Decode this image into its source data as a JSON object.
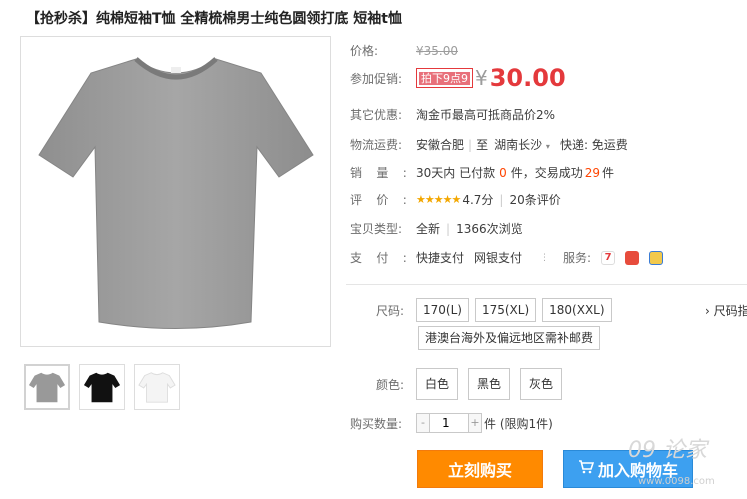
{
  "title": "【抢秒杀】纯棉短袖T恤 全精梳棉男士纯色圆领打底 短袖t恤",
  "price": {
    "label": "价格:",
    "original": "¥35.00"
  },
  "promo": {
    "label": "参加促销:",
    "tag": "拍下9点9",
    "yen": "¥",
    "price": "30.00"
  },
  "other": {
    "label": "其它优惠:",
    "text": "淘金币最高可抵商品价2%"
  },
  "shipping": {
    "label": "物流运费:",
    "from": "安徽合肥",
    "to_prefix": "至",
    "to": "湖南长沙",
    "express": "快递: 免运费"
  },
  "sales": {
    "label": "销量:",
    "prefix": "30天内 已付款",
    "paid": "0",
    "mid": "件，交易成功",
    "success": "29",
    "suffix": "件"
  },
  "rating": {
    "label": "评价:",
    "stars": "★★★★★",
    "score": "4.7分",
    "reviews": "20条评价"
  },
  "type": {
    "label": "宝贝类型:",
    "condition": "全新",
    "views": "1366次浏览"
  },
  "payment": {
    "label": "支付:",
    "methods": [
      "快捷支付",
      "网银支付"
    ],
    "service_label": "服务:"
  },
  "size": {
    "label": "尺码:",
    "options": [
      "170(L)",
      "175(XL)",
      "180(XXL)"
    ],
    "note": "港澳台海外及偏远地区需补邮费",
    "guide": "› 尺码指"
  },
  "color": {
    "label": "颜色:",
    "options": [
      "白色",
      "黑色",
      "灰色"
    ]
  },
  "quantity": {
    "label": "购买数量:",
    "value": "1",
    "minus": "-",
    "plus": "+",
    "unit": "件 (限购1件)"
  },
  "buttons": {
    "buy": "立刻购买",
    "cart": "加入购物车"
  },
  "watermark": {
    "text": "09 论家",
    "url": "www.0098.com"
  },
  "colors": {
    "accent": "#e4393c",
    "orange": "#ff8a00",
    "blue": "#3da0f0",
    "tshirt_gray": "#999999"
  }
}
